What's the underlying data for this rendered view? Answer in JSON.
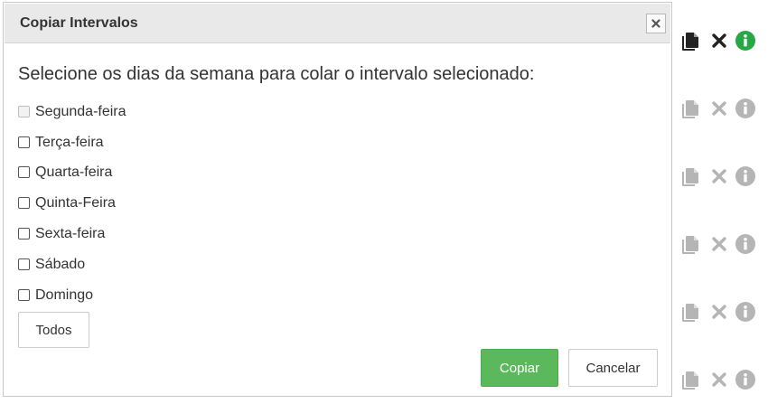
{
  "dialog": {
    "title": "Copiar Intervalos",
    "instruction": "Selecione os dias da semana para colar o intervalo selecionado:",
    "days": [
      {
        "label": "Segunda-feira",
        "checked": false,
        "disabled": true
      },
      {
        "label": "Terça-feira",
        "checked": false,
        "disabled": false
      },
      {
        "label": "Quarta-feira",
        "checked": false,
        "disabled": false
      },
      {
        "label": "Quinta-Feira",
        "checked": false,
        "disabled": false
      },
      {
        "label": "Sexta-feira",
        "checked": false,
        "disabled": false
      },
      {
        "label": "Sábado",
        "checked": false,
        "disabled": false
      },
      {
        "label": "Domingo",
        "checked": false,
        "disabled": false
      }
    ],
    "all_button_label": "Todos",
    "copy_button_label": "Copiar",
    "cancel_button_label": "Cancelar"
  },
  "row_actions": [
    {
      "icons": [
        "copy-icon",
        "delete-icon",
        "info-icon"
      ],
      "active": true
    },
    {
      "icons": [
        "copy-icon",
        "delete-icon",
        "info-icon"
      ],
      "active": false
    },
    {
      "icons": [
        "copy-icon",
        "delete-icon",
        "info-icon"
      ],
      "active": false
    },
    {
      "icons": [
        "copy-icon",
        "delete-icon",
        "info-icon"
      ],
      "active": false
    },
    {
      "icons": [
        "copy-icon",
        "delete-icon",
        "info-icon"
      ],
      "active": false
    },
    {
      "icons": [
        "copy-icon",
        "delete-icon",
        "info-icon"
      ],
      "active": false
    }
  ],
  "colors": {
    "primary_button": "#5cb85c",
    "info_active": "#28a745",
    "icon_active": "#222222",
    "icon_inactive": "#b5b5b5",
    "header_bg": "#e9e9e9"
  }
}
